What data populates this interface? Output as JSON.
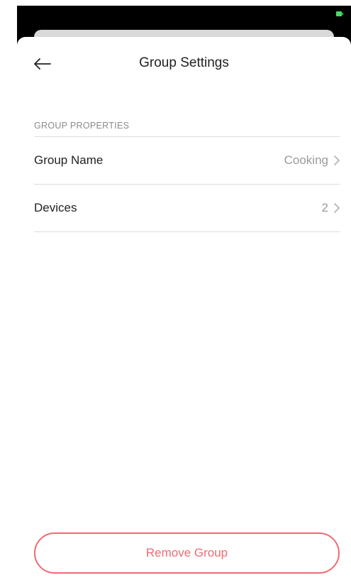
{
  "header": {
    "title": "Group Settings"
  },
  "section": {
    "title": "GROUP PROPERTIES"
  },
  "rows": [
    {
      "label": "Group Name",
      "value": "Cooking"
    },
    {
      "label": "Devices",
      "value": "2"
    }
  ],
  "actions": {
    "remove_label": "Remove Group"
  },
  "colors": {
    "accent": "#ef6a72",
    "battery": "#4cd964"
  },
  "icons": {
    "back": "arrow-left-icon",
    "chevron": "chevron-right-icon",
    "battery": "battery-icon"
  }
}
